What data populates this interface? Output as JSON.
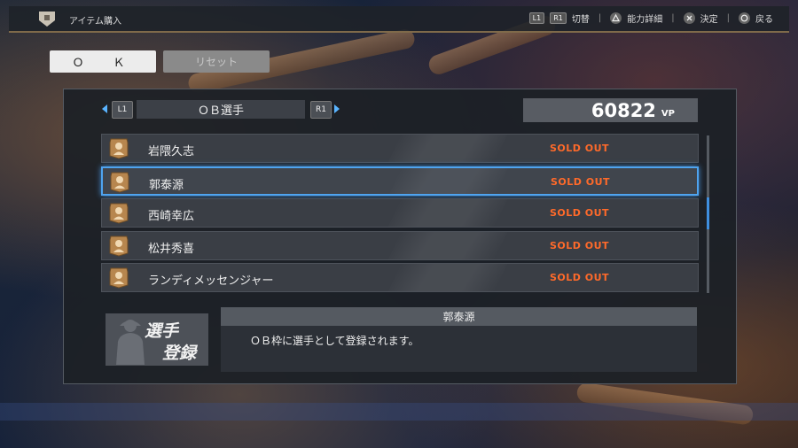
{
  "header": {
    "title": "アイテム購入",
    "hints": [
      {
        "buttons": [
          "L1",
          "R1"
        ],
        "label": "切替"
      },
      {
        "button_icon": "triangle-button-icon",
        "label": "能力詳細"
      },
      {
        "button_icon": "cross-button-icon",
        "label": "決定"
      },
      {
        "button_icon": "circle-button-icon",
        "label": "戻る"
      }
    ]
  },
  "actions": {
    "ok_label": "Ｏ　Ｋ",
    "reset_label": "リセット"
  },
  "category": {
    "left_tag": "L1",
    "name": "ＯＢ選手",
    "right_tag": "R1"
  },
  "points": {
    "value": "60822",
    "unit": "VP"
  },
  "items": [
    {
      "name": "岩隈久志",
      "status": "SOLD OUT",
      "selected": false
    },
    {
      "name": "郭泰源",
      "status": "SOLD OUT",
      "selected": true
    },
    {
      "name": "西崎幸広",
      "status": "SOLD OUT",
      "selected": false
    },
    {
      "name": "松井秀喜",
      "status": "SOLD OUT",
      "selected": false
    },
    {
      "name": "ランディメッセンジャー",
      "status": "SOLD OUT",
      "selected": false
    }
  ],
  "badge": {
    "line1": "選手",
    "line2": "登録"
  },
  "description": {
    "title": "郭泰源",
    "text": "ＯＢ枠に選手として登録されます。"
  },
  "colors": {
    "sold_out": "#ff6a2a",
    "selection": "#4fa4f0",
    "arrow": "#5ab4ff"
  }
}
